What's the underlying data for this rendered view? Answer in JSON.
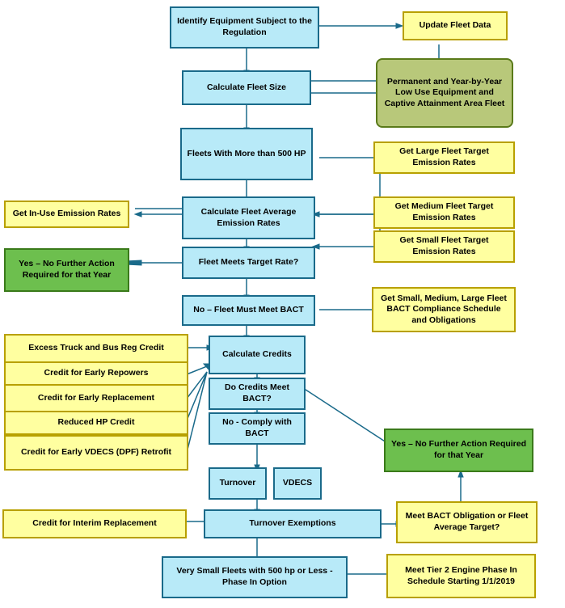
{
  "boxes": {
    "identify": "Identify Equipment Subject to the Regulation",
    "update_fleet": "Update Fleet Data",
    "calc_fleet_size": "Calculate Fleet Size",
    "perm_low_use": "Permanent and Year-by-Year Low Use Equipment and Captive Attainment Area Fleet",
    "fleets_500": "Fleets With More than 500 HP",
    "large_target": "Get Large Fleet Target Emission Rates",
    "calc_avg": "Calculate Fleet Average Emission Rates",
    "medium_target": "Get Medium Fleet Target Emission Rates",
    "in_use": "Get In-Use Emission Rates",
    "small_target": "Get Small Fleet Target Emission Rates",
    "yes_no_action1": "Yes – No Further Action Required for that Year",
    "meets_target": "Fleet Meets Target Rate?",
    "no_bact": "No – Fleet Must Meet BACT",
    "small_med_large": "Get Small, Medium, Large Fleet BACT Compliance Schedule and Obligations",
    "excess_truck": "Excess Truck and Bus Reg Credit",
    "calc_credits": "Calculate Credits",
    "early_repowers": "Credit for Early Repowers",
    "do_credits": "Do Credits Meet BACT?",
    "early_replace": "Credit for Early Replacement",
    "no_comply": "No - Comply with BACT",
    "reduced_hp": "Reduced HP Credit",
    "yes_no_action2": "Yes – No Further Action Required for that Year",
    "early_vdecs": "Credit for Early VDECS (DPF) Retrofit",
    "turnover": "Turnover",
    "vdecs": "VDECS",
    "interim_replace": "Credit for Interim Replacement",
    "turnover_exempt": "Turnover Exemptions",
    "meet_bact_oblig": "Meet BACT Obligation or Fleet Average Target?",
    "very_small": "Very Small Fleets with 500 hp or Less - Phase In Option",
    "meet_tier2": "Meet Tier 2 Engine Phase In Schedule Starting 1/1/2019"
  }
}
